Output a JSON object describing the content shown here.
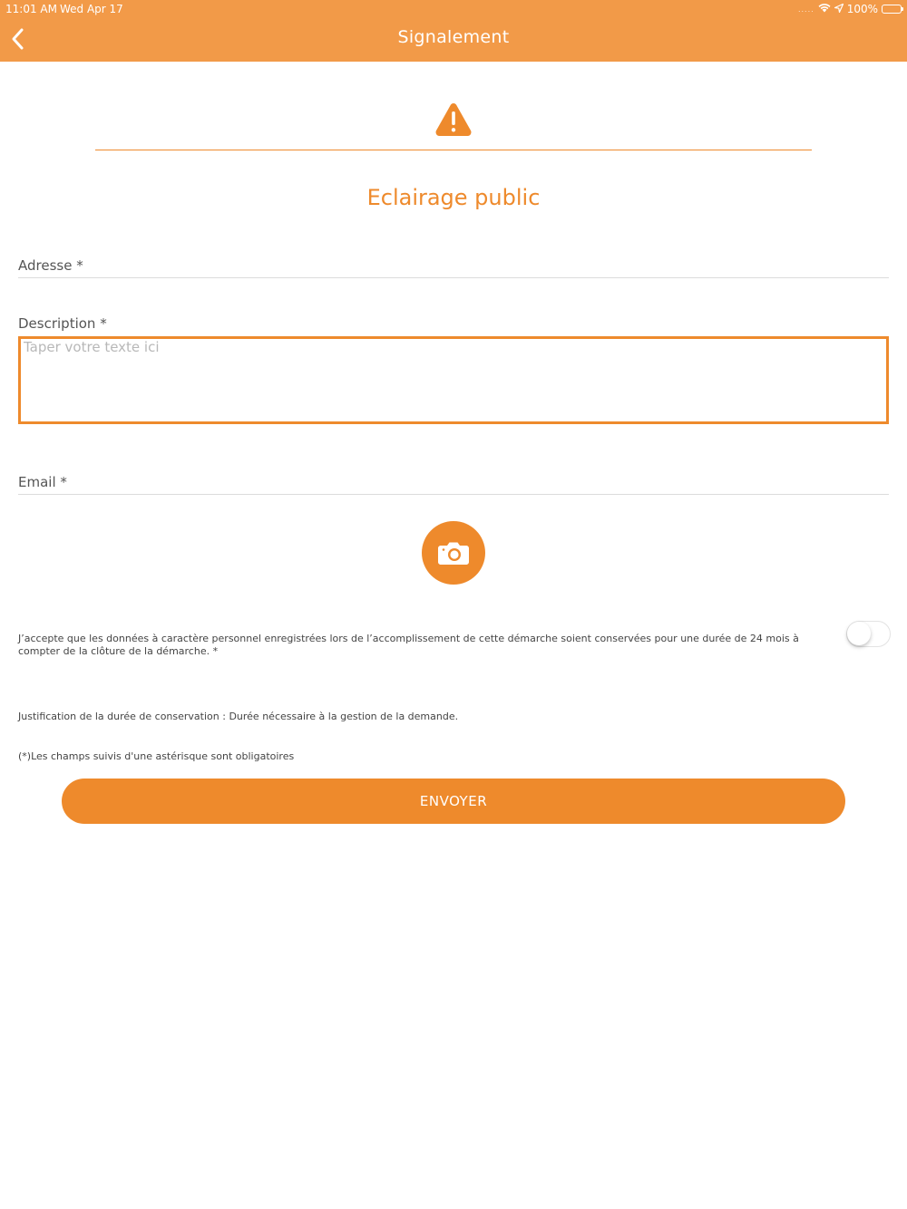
{
  "status_bar": {
    "time": "11:01 AM",
    "date": "Wed Apr 17",
    "battery_text": "100%",
    "signal_dots": "....."
  },
  "header": {
    "title": "Signalement",
    "back_icon": "chevron-left-icon"
  },
  "category": {
    "icon": "warning-icon",
    "title": "Eclairage public"
  },
  "form": {
    "address_label": "Adresse *",
    "description_label": "Description *",
    "description_placeholder": "Taper votre texte ici",
    "email_label": "Email *",
    "camera_icon": "camera-icon",
    "consent_text": "J’accepte que les données à caractère personnel enregistrées lors de l’accomplissement de cette démarche soient conservées pour une durée de 24 mois à compter de la clôture de la démarche. *",
    "consent_toggle_on": false,
    "justification_text": "Justification de la durée de conservation : Durée nécessaire à la gestion de la demande.",
    "required_note": "(*)Les champs suivis d'une astérisque sont obligatoires",
    "submit_label": "ENVOYER"
  },
  "colors": {
    "header_bg": "#f29a48",
    "accent": "#ee8a2c",
    "text": "#555555"
  }
}
